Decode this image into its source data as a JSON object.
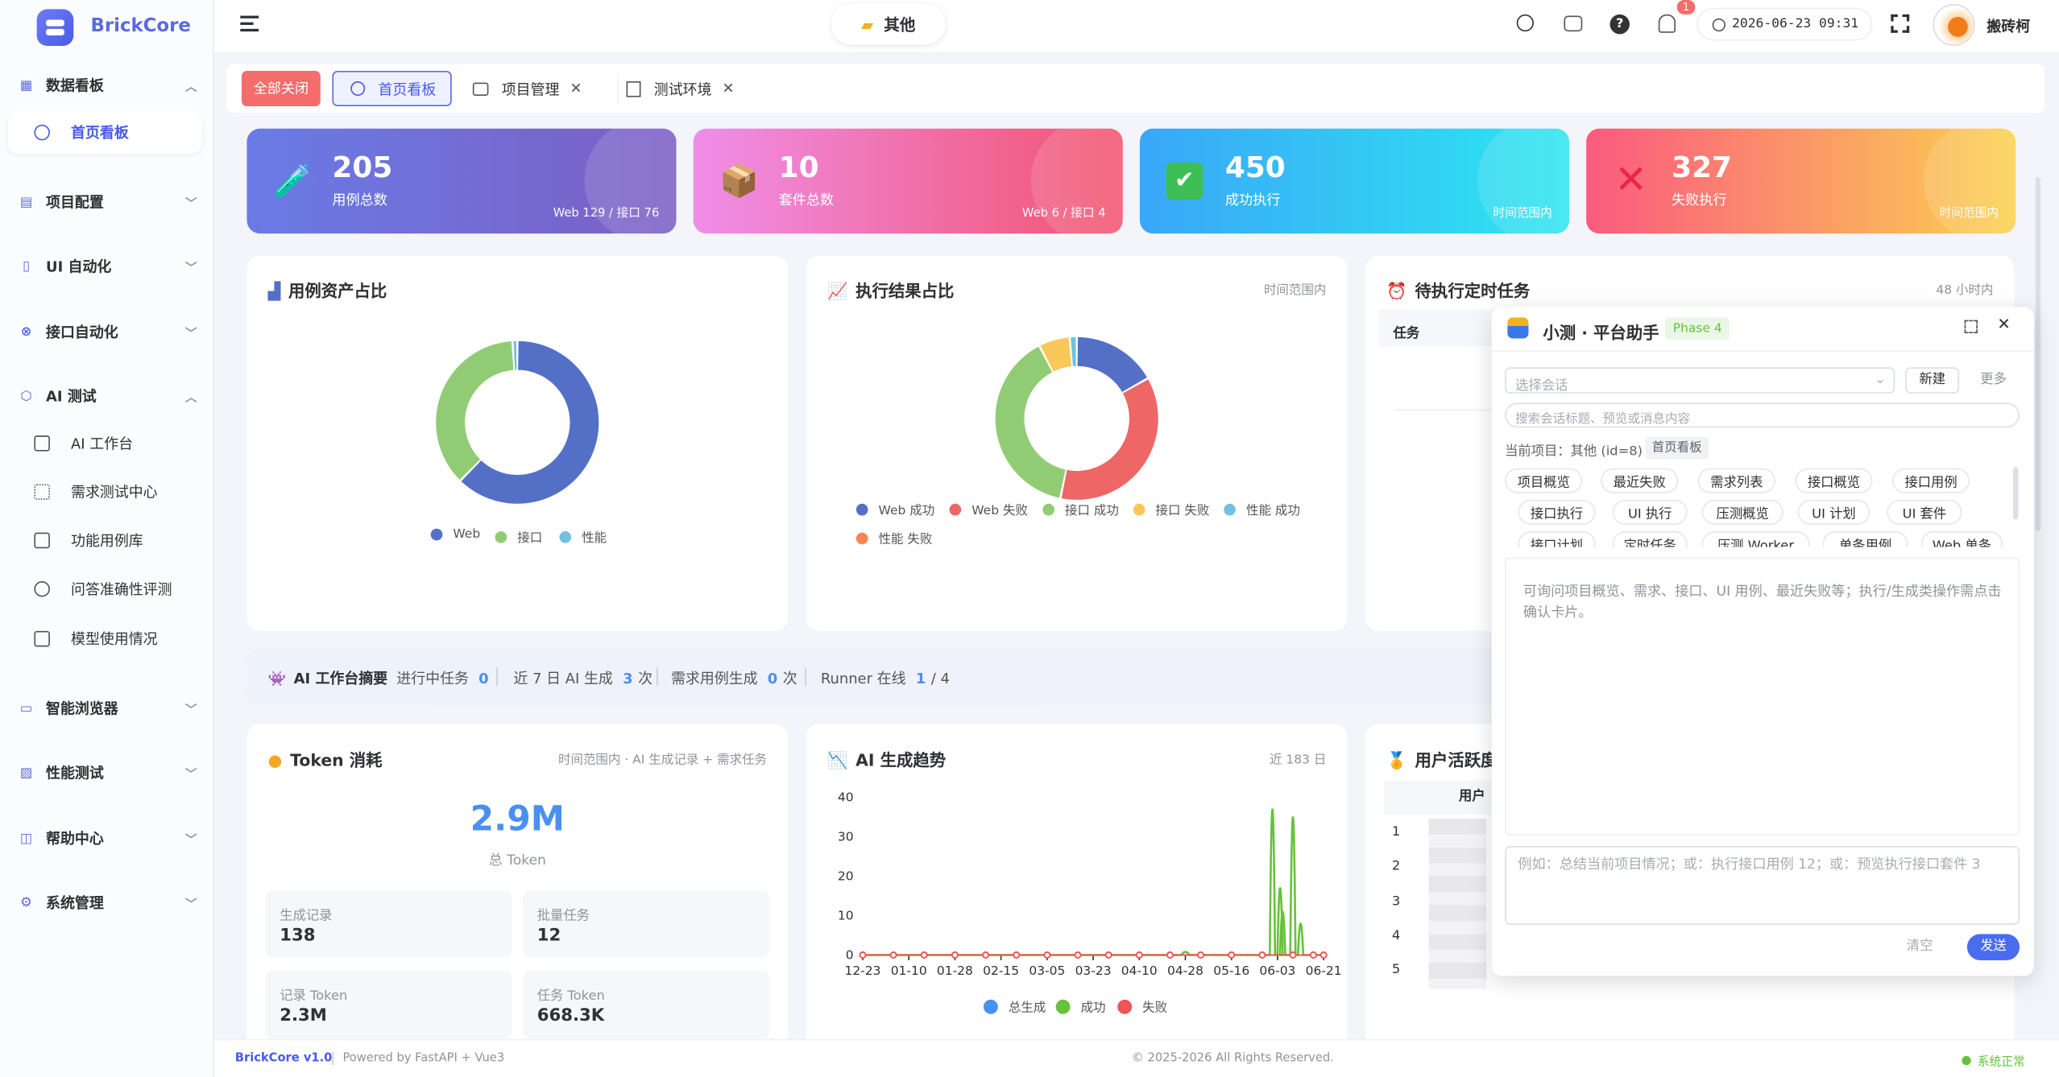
{
  "app": {
    "name": "BrickCore"
  },
  "sidebar": {
    "groups": [
      {
        "label": "数据看板",
        "icon": "dashboard-icon"
      },
      {
        "label": "项目配置",
        "icon": "project-icon"
      },
      {
        "label": "UI 自动化",
        "icon": "ui-auto-icon"
      },
      {
        "label": "接口自动化",
        "icon": "api-icon"
      },
      {
        "label": "AI 测试",
        "icon": "ai-chip-icon"
      },
      {
        "label": "智能浏览器",
        "icon": "browser-icon"
      },
      {
        "label": "性能测试",
        "icon": "performance-icon"
      },
      {
        "label": "帮助中心",
        "icon": "book-icon"
      },
      {
        "label": "系统管理",
        "icon": "gear-icon"
      }
    ],
    "dashboard_children": [
      {
        "label": "首页看板"
      }
    ],
    "ai_children": [
      {
        "label": "AI 工作台"
      },
      {
        "label": "需求测试中心"
      },
      {
        "label": "功能用例库"
      },
      {
        "label": "问答准确性评测"
      },
      {
        "label": "模型使用情况"
      }
    ]
  },
  "topbar": {
    "project": "其他",
    "datetime": "2026-06-23 09:31",
    "user": "搬砖柯",
    "notify_count": "1"
  },
  "tabs": {
    "close_all": "全部关闭",
    "items": [
      {
        "label": "首页看板"
      },
      {
        "label": "项目管理"
      },
      {
        "label": "测试环境"
      }
    ]
  },
  "stats": [
    {
      "value": "205",
      "label": "用例总数",
      "foot": "Web 129 / 接口 76",
      "colors": [
        "#6a7be6",
        "#7b5fc4"
      ]
    },
    {
      "value": "10",
      "label": "套件总数",
      "foot": "Web 6 / 接口 4",
      "colors": [
        "#ef8ee9",
        "#f2546f"
      ]
    },
    {
      "value": "450",
      "label": "成功执行",
      "foot": "时间范围内",
      "colors": [
        "#3aa7f8",
        "#2ee6f0"
      ]
    },
    {
      "value": "327",
      "label": "失败执行",
      "foot": "时间范围内",
      "colors": [
        "#fb5a7f",
        "#fbd250"
      ]
    }
  ],
  "asset_chart": {
    "title": "用例资产占比",
    "legend": [
      {
        "name": "Web",
        "color": "#5470c6"
      },
      {
        "name": "接口",
        "color": "#91cc75"
      },
      {
        "name": "性能",
        "color": "#73c0de"
      }
    ],
    "values": [
      129,
      76,
      2
    ]
  },
  "result_chart": {
    "title": "执行结果占比",
    "note": "时间范围内",
    "legend": [
      {
        "name": "Web 成功",
        "color": "#5470c6"
      },
      {
        "name": "Web 失败",
        "color": "#ee6666"
      },
      {
        "name": "接口 成功",
        "color": "#91cc75"
      },
      {
        "name": "接口 失败",
        "color": "#fac858"
      },
      {
        "name": "性能 成功",
        "color": "#73c0de"
      },
      {
        "name": "性能 失败",
        "color": "#fc8452"
      }
    ],
    "values": [
      60,
      130,
      140,
      22,
      5,
      0
    ]
  },
  "schedule": {
    "title": "待执行定时任务",
    "note": "48 小时内",
    "col": "任务"
  },
  "ai_summary": {
    "title": "AI 工作台摘要",
    "items": [
      {
        "label": "进行中任务",
        "value": "0",
        "unit": ""
      },
      {
        "label": "近 7 日 AI 生成",
        "value": "3",
        "unit": "次"
      },
      {
        "label": "需求用例生成",
        "value": "0",
        "unit": "次"
      },
      {
        "label": "Runner 在线",
        "value": "1",
        "unit": "/ 4"
      }
    ]
  },
  "token": {
    "title": "Token 消耗",
    "note": "时间范围内 · AI 生成记录 + 需求任务",
    "total": "2.9M",
    "total_label": "总 Token",
    "boxes": [
      {
        "label": "生成记录",
        "value": "138"
      },
      {
        "label": "批量任务",
        "value": "12"
      },
      {
        "label": "记录 Token",
        "value": "2.3M"
      },
      {
        "label": "任务 Token",
        "value": "668.3K"
      }
    ]
  },
  "trend": {
    "title": "AI 生成趋势",
    "note": "近 183 日"
  },
  "chart_data": {
    "type": "line",
    "x": [
      "12-23",
      "01-10",
      "01-28",
      "02-15",
      "03-05",
      "03-23",
      "04-10",
      "04-28",
      "05-16",
      "06-03",
      "06-21"
    ],
    "ylim": [
      0,
      40
    ],
    "yticks": [
      0,
      10,
      20,
      30,
      40
    ],
    "series": [
      {
        "name": "总生成",
        "color": "#4a90f0",
        "values": [
          0,
          0,
          0,
          0,
          0,
          0,
          0,
          1,
          0,
          0,
          0
        ]
      },
      {
        "name": "成功",
        "color": "#67c23a",
        "values": [
          0,
          0,
          0,
          0,
          0,
          0,
          0,
          1,
          0,
          0,
          0
        ]
      },
      {
        "name": "失败",
        "color": "#ee5555",
        "values": [
          0,
          0,
          0,
          0,
          0,
          0,
          0,
          0,
          0,
          0,
          0
        ]
      }
    ],
    "peaks": [
      {
        "x": "06-01",
        "y": 37
      },
      {
        "x": "06-09",
        "y": 35
      },
      {
        "x": "06-04",
        "y": 17
      },
      {
        "x": "06-05",
        "y": 11
      },
      {
        "x": "06-12",
        "y": 8
      }
    ]
  },
  "activity": {
    "title": "用户活跃度",
    "col": "用户",
    "rows": [
      "1",
      "2",
      "3",
      "4",
      "5"
    ]
  },
  "assistant": {
    "title": "小测 · 平台助手",
    "phase": "Phase 4",
    "session_placeholder": "选择会话",
    "new_btn": "新建",
    "more_btn": "更多",
    "search_placeholder": "搜索会话标题、预览或消息内容",
    "current_project": "当前项目：其他 (id=8)",
    "current_page": "首页看板",
    "chips": [
      "项目概览",
      "最近失败",
      "需求列表",
      "接口概览",
      "接口用例",
      "接口执行",
      "UI 执行",
      "压测概览",
      "UI 计划",
      "UI 套件",
      "接口计划",
      "定时任务",
      "压测 Worker",
      "单条用例",
      "Web 单条"
    ],
    "hint": "可询问项目概览、需求、接口、UI 用例、最近失败等；执行/生成类操作需点击确认卡片。",
    "input_placeholder": "例如：总结当前项目情况；或：执行接口用例 12；或：预览执行接口套件 3",
    "clear_btn": "清空",
    "send_btn": "发送"
  },
  "footer": {
    "version": "BrickCore v1.0",
    "powered": "Powered by FastAPI + Vue3",
    "copyright": "© 2025-2026 All Rights Reserved.",
    "status": "系统正常"
  }
}
